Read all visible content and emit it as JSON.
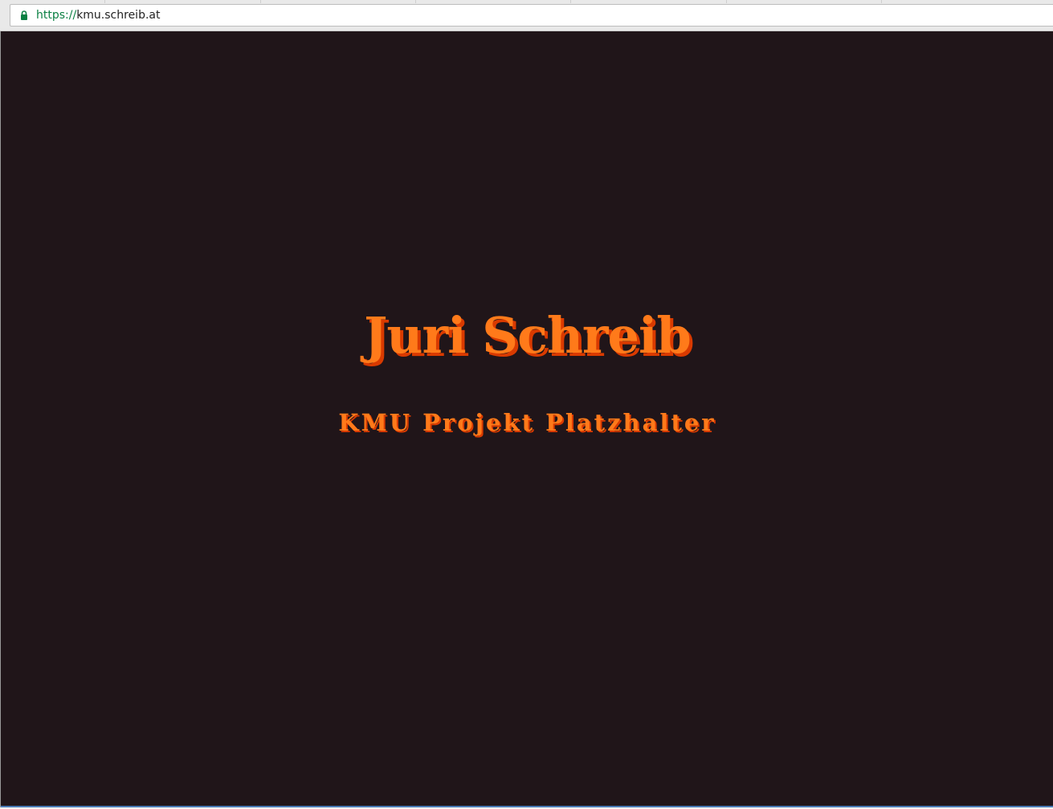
{
  "browser": {
    "url_scheme": "https://",
    "url_host": "kmu.schreib.at",
    "lock_icon": "lock-icon",
    "secure_color": "#0b8043"
  },
  "page": {
    "background": "#201519",
    "title": "Juri Schreib",
    "subtitle": "KMU Projekt Platzhalter",
    "text_color": "#ff7a1a",
    "shadow_color": "#d93a00"
  }
}
